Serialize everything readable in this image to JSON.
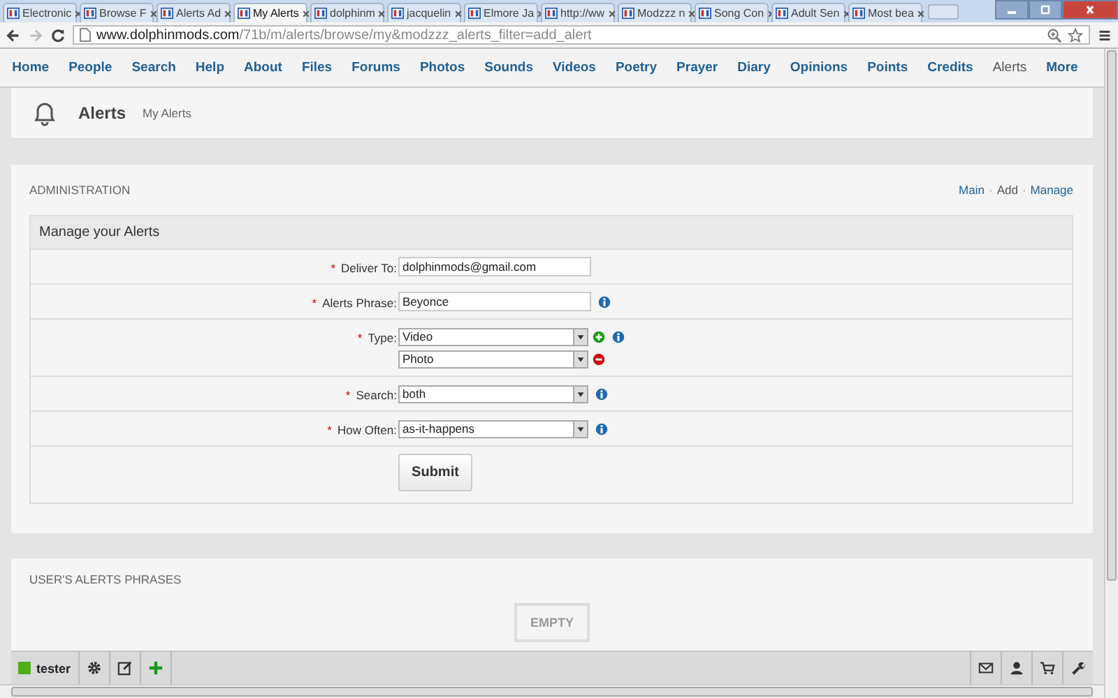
{
  "browser": {
    "tabs": [
      {
        "title": "Electronic",
        "selected": false
      },
      {
        "title": "Browse F",
        "selected": false
      },
      {
        "title": "Alerts Ad",
        "selected": false
      },
      {
        "title": "My Alerts",
        "selected": true
      },
      {
        "title": "dolphinm",
        "selected": false
      },
      {
        "title": "jacquelin",
        "selected": false
      },
      {
        "title": "Elmore Ja",
        "selected": false
      },
      {
        "title": "http://ww",
        "selected": false
      },
      {
        "title": "Modzzz n",
        "selected": false
      },
      {
        "title": "Song Con",
        "selected": false
      },
      {
        "title": "Adult Sen",
        "selected": false
      },
      {
        "title": "Most bea",
        "selected": false
      }
    ],
    "url": {
      "host": "www.dolphinmods.com",
      "path": "/71b/m/alerts/browse/my&modzzz_alerts_filter=add_alert"
    }
  },
  "nav": [
    {
      "label": "Home",
      "selected": false
    },
    {
      "label": "People",
      "selected": false
    },
    {
      "label": "Search",
      "selected": false
    },
    {
      "label": "Help",
      "selected": false
    },
    {
      "label": "About",
      "selected": false
    },
    {
      "label": "Files",
      "selected": false
    },
    {
      "label": "Forums",
      "selected": false
    },
    {
      "label": "Photos",
      "selected": false
    },
    {
      "label": "Sounds",
      "selected": false
    },
    {
      "label": "Videos",
      "selected": false
    },
    {
      "label": "Poetry",
      "selected": false
    },
    {
      "label": "Prayer",
      "selected": false
    },
    {
      "label": "Diary",
      "selected": false
    },
    {
      "label": "Opinions",
      "selected": false
    },
    {
      "label": "Points",
      "selected": false
    },
    {
      "label": "Credits",
      "selected": false
    },
    {
      "label": "Alerts",
      "selected": true
    },
    {
      "label": "More",
      "selected": false
    }
  ],
  "header": {
    "title": "Alerts",
    "subtitle": "My Alerts"
  },
  "admin": {
    "heading": "ADMINISTRATION",
    "separator": "·",
    "links": [
      {
        "label": "Main",
        "selected": false
      },
      {
        "label": "Add",
        "selected": true
      },
      {
        "label": "Manage",
        "selected": false
      }
    ],
    "form": {
      "title": "Manage your Alerts",
      "fields": [
        {
          "label": "Deliver To:",
          "required_mark": "*",
          "info": false,
          "inputs": [
            {
              "kind": "text",
              "value": "dolphinmods@gmail.com"
            }
          ]
        },
        {
          "label": "Alerts Phrase:",
          "required_mark": "*",
          "info": true,
          "inputs": [
            {
              "kind": "text",
              "value": "Beyonce"
            }
          ]
        },
        {
          "label": "Type:",
          "required_mark": "*",
          "info": true,
          "inputs": [
            {
              "kind": "select",
              "value": "Video",
              "can_add": true
            },
            {
              "kind": "select",
              "value": "Photo",
              "can_remove": true
            }
          ]
        },
        {
          "label": "Search:",
          "required_mark": "*",
          "info": true,
          "inputs": [
            {
              "kind": "select",
              "value": "both"
            }
          ]
        },
        {
          "label": "How Often:",
          "required_mark": "*",
          "info": true,
          "inputs": [
            {
              "kind": "select",
              "value": "as-it-happens"
            }
          ]
        }
      ],
      "submit": "Submit"
    }
  },
  "phrases": {
    "heading": "USER'S ALERTS PHRASES",
    "empty": "EMPTY"
  },
  "toolbar": {
    "user": "tester"
  }
}
